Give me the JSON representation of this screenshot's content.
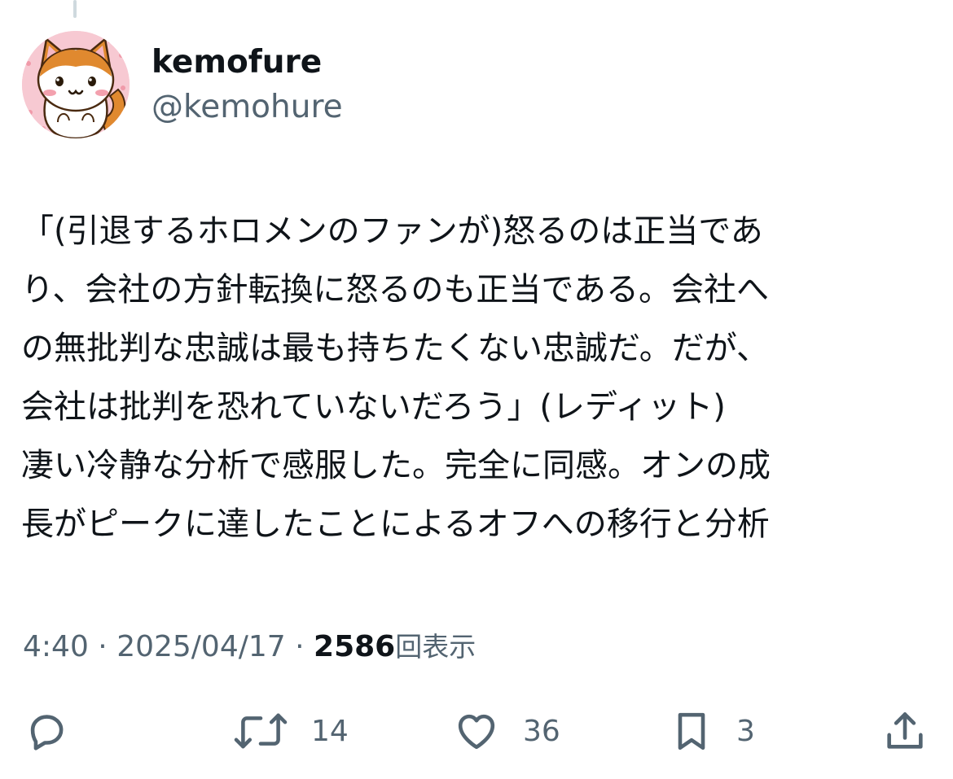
{
  "author": {
    "display_name": "kemofure",
    "handle": "@kemohure",
    "avatar_icon": "cat-avatar-icon"
  },
  "tweet": {
    "lines": [
      "「(引退するホロメンのファンが)怒るのは正当であ",
      "り、会社の方針転換に怒るのも正当である。会社へ",
      "の無批判な忠誠は最も持ちたくない忠誠だ。だが、",
      "会社は批判を恐れていないだろう」(レディット)",
      "凄い冷静な分析で感服した。完全に同感。オンの成",
      "長がピークに達したことによるオフへの移行と分析"
    ]
  },
  "meta": {
    "time": "4:40",
    "separator": " · ",
    "date": "2025/04/17",
    "views_count": "2586",
    "views_label": "回表示"
  },
  "actions": {
    "reply": {
      "icon": "reply-icon"
    },
    "retweet": {
      "icon": "retweet-icon",
      "count": "14"
    },
    "like": {
      "icon": "heart-icon",
      "count": "36"
    },
    "bookmark": {
      "icon": "bookmark-icon",
      "count": "3"
    },
    "share": {
      "icon": "share-icon"
    }
  },
  "colors": {
    "text_primary": "#0f1419",
    "text_secondary": "#536471",
    "thread_line": "#cfd9de"
  }
}
